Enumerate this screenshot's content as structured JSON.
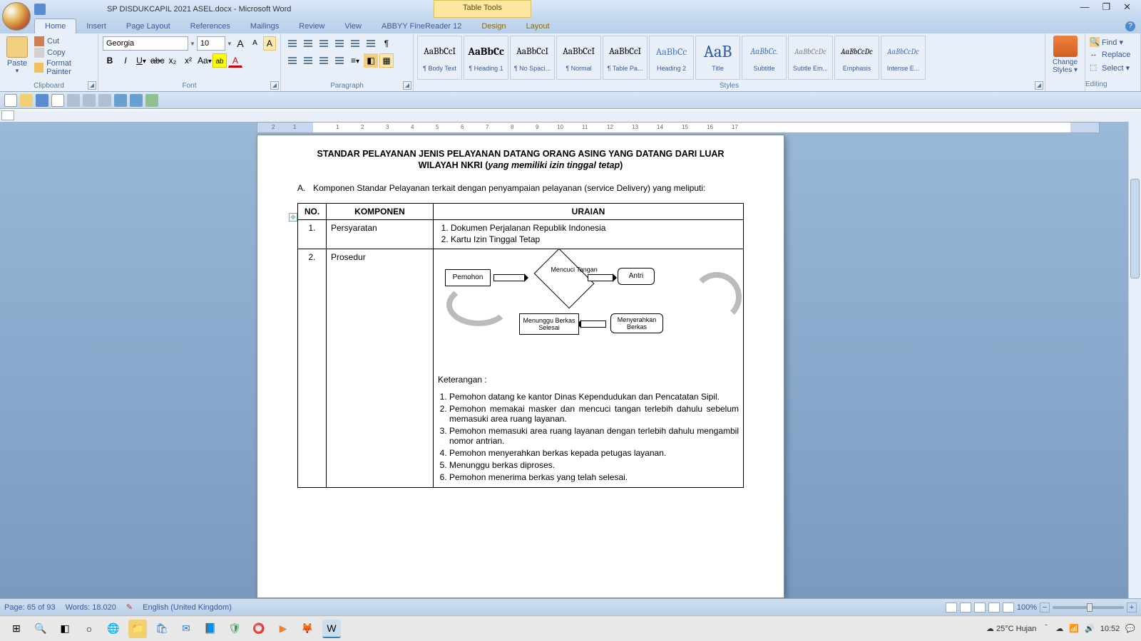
{
  "title_bar": {
    "doc_title": "SP  DISDUKCAPIL 2021 ASEL.docx - Microsoft Word",
    "context_tab": "Table Tools"
  },
  "win_ctrl": {
    "min": "—",
    "max": "❐",
    "close": "✕"
  },
  "tabs": [
    "Home",
    "Insert",
    "Page Layout",
    "References",
    "Mailings",
    "Review",
    "View",
    "ABBYY FineReader 12",
    "Design",
    "Layout"
  ],
  "ribbon": {
    "clipboard": {
      "label": "Clipboard",
      "paste": "Paste",
      "cut": "Cut",
      "copy": "Copy",
      "fmt": "Format Painter"
    },
    "font": {
      "label": "Font",
      "name": "Georgia",
      "size": "10"
    },
    "paragraph": {
      "label": "Paragraph"
    },
    "styles": {
      "label": "Styles",
      "items": [
        {
          "prev": "AaBbCcI",
          "name": "¶ Body Text",
          "ps": "13px"
        },
        {
          "prev": "AaBbCc",
          "name": "¶ Heading 1",
          "ps": "15px",
          "bold": true
        },
        {
          "prev": "AaBbCcI",
          "name": "¶ No Spaci...",
          "ps": "13px"
        },
        {
          "prev": "AaBbCcI",
          "name": "¶ Normal",
          "ps": "13px"
        },
        {
          "prev": "AaBbCcI",
          "name": "¶ Table Pa...",
          "ps": "13px"
        },
        {
          "prev": "AaBbCc",
          "name": "Heading 2",
          "ps": "14px",
          "color": "#4a7ac0"
        },
        {
          "prev": "AaB",
          "name": "Title",
          "ps": "24px",
          "color": "#2a5a9a"
        },
        {
          "prev": "AaBbCc.",
          "name": "Subtitle",
          "ps": "12px",
          "italic": true,
          "color": "#4a7ac0"
        },
        {
          "prev": "AaBbCcDc",
          "name": "Subtle Em...",
          "ps": "11px",
          "italic": true,
          "color": "#888"
        },
        {
          "prev": "AaBbCcDc",
          "name": "Emphasis",
          "ps": "11px",
          "italic": true
        },
        {
          "prev": "AaBbCcDc",
          "name": "Intense E...",
          "ps": "11px",
          "italic": true,
          "color": "#4a7ac0"
        }
      ]
    },
    "change_styles": {
      "l1": "Change",
      "l2": "Styles ▾"
    },
    "editing": {
      "label": "Editing",
      "find": "Find ▾",
      "replace": "Replace",
      "select": "Select ▾"
    }
  },
  "document": {
    "title_line1": "STANDAR PELAYANAN JENIS PELAYANAN DATANG ORANG ASING YANG DATANG DARI LUAR",
    "title_line2_a": "WILAYAH NKRI (",
    "title_line2_b": "yang memiliki izin tinggal tetap",
    "title_line2_c": ")",
    "section_a": "Komponen Standar Pelayanan terkait dengan penyampaian pelayanan (service Delivery) yang meliputi:",
    "headers": {
      "no": "NO.",
      "komp": "KOMPONEN",
      "ur": "URAIAN"
    },
    "row1": {
      "no": "1.",
      "komp": "Persyaratan",
      "items": [
        "Dokumen Perjalanan Republik Indonesia",
        "Kartu Izin Tinggal Tetap"
      ]
    },
    "row2": {
      "no": "2.",
      "komp": "Prosedur",
      "flow": {
        "pemohon": "Pemohon",
        "mencuci": "Mencuci Tangan",
        "antri": "Antri",
        "menyerahkan": "Menyerahkan Berkas",
        "menunggu": "Menunggu Berkas Selesai"
      },
      "ket_label": "Keterangan :",
      "ket": [
        "Pemohon datang ke kantor Dinas Kependudukan dan Pencatatan Sipil.",
        "Pemohon memakai masker dan mencuci tangan terlebih dahulu sebelum memasuki area ruang layanan.",
        "Pemohon memasuki area ruang layanan dengan terlebih dahulu mengambil nomor antrian.",
        "Pemohon menyerahkan berkas kepada petugas layanan.",
        "Menunggu berkas diproses.",
        "Pemohon menerima berkas yang telah selesai."
      ]
    }
  },
  "status_bar": {
    "page": "Page: 65 of 93",
    "words": "Words: 18.020",
    "lang": "English (United Kingdom)",
    "zoom": "100%"
  },
  "taskbar": {
    "weather": "25°C  Hujan",
    "time": "10:52"
  }
}
